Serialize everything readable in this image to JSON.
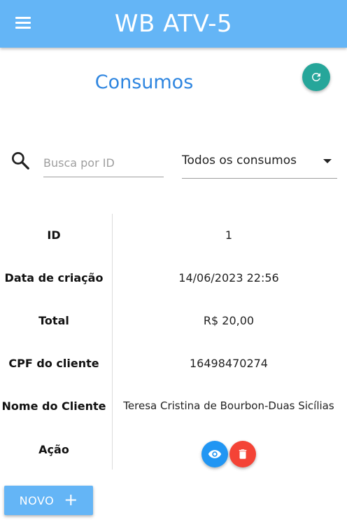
{
  "appbar": {
    "title": "WB ATV-5"
  },
  "page": {
    "title": "Consumos"
  },
  "search": {
    "placeholder": "Busca por ID"
  },
  "filter": {
    "selected": "Todos os consumos"
  },
  "details": [
    {
      "label": "ID",
      "value": "1"
    },
    {
      "label": "Data de criação",
      "value": "14/06/2023 22:56"
    },
    {
      "label": "Total",
      "value": "R$ 20,00"
    },
    {
      "label": "CPF do cliente",
      "value": "16498470274"
    },
    {
      "label": "Nome do Cliente",
      "value": "Teresa Cristina de Bourbon-Duas Sicílias"
    },
    {
      "label": "Ação",
      "value": ""
    }
  ],
  "actions": {
    "new_label": "NOVO",
    "new_icon": "+"
  },
  "colors": {
    "appbar": "#64b5f6",
    "title": "#2f86e0",
    "refresh": "#26a69a",
    "view": "#2196f3",
    "delete": "#f44336"
  }
}
